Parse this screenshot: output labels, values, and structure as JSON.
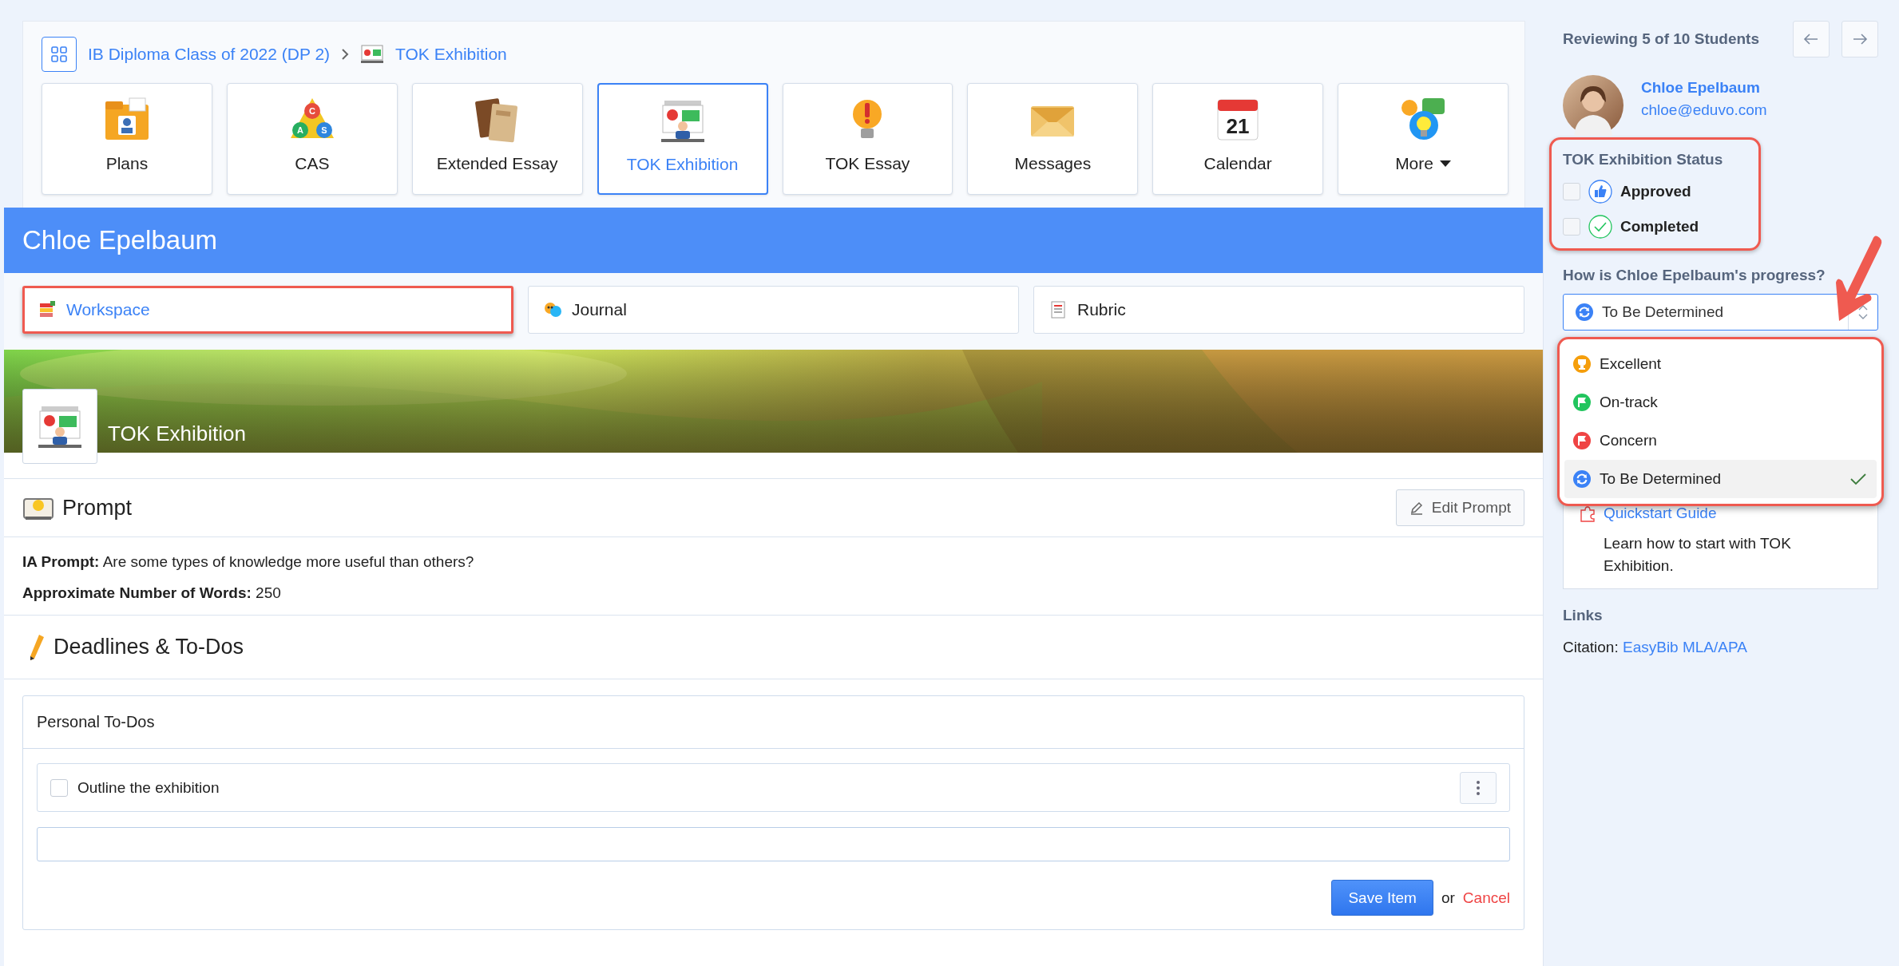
{
  "breadcrumb": [
    {
      "label": "IB Diploma Class of 2022 (DP 2)"
    },
    {
      "label": "TOK Exhibition"
    }
  ],
  "apps": [
    {
      "label": "Plans",
      "kind": "app",
      "selected": false
    },
    {
      "label": "CAS",
      "kind": "app",
      "selected": false,
      "icon_letters": [
        "C",
        "A",
        "S"
      ]
    },
    {
      "label": "Extended Essay",
      "kind": "app",
      "selected": false
    },
    {
      "label": "TOK Exhibition",
      "kind": "app",
      "selected": true
    },
    {
      "label": "TOK Essay",
      "kind": "app",
      "selected": false
    },
    {
      "label": "Messages",
      "kind": "app",
      "selected": false
    },
    {
      "label": "Calendar",
      "kind": "app",
      "selected": false,
      "icon_text": "21"
    },
    {
      "label": "More",
      "kind": "menu",
      "selected": false
    }
  ],
  "student": {
    "name": "Chloe Epelbaum"
  },
  "section_tabs": [
    {
      "label": "Workspace",
      "selected": true
    },
    {
      "label": "Journal",
      "selected": false
    },
    {
      "label": "Rubric",
      "selected": false
    }
  ],
  "banner": {
    "title": "TOK Exhibition"
  },
  "prompt": {
    "title": "Prompt",
    "edit_button": "Edit Prompt",
    "details": [
      "**IA Prompt:** Are some types of knowledge more useful than others?",
      "**Approximate Number of Words:** 250"
    ]
  },
  "deadlines": {
    "title": "Deadlines & To-Dos"
  },
  "todos": {
    "title": "Personal To-Dos",
    "items": [
      {
        "text": "Outline the exhibition",
        "checked": false
      }
    ],
    "save_button": "Save Item",
    "separator": "or",
    "cancel_link": "Cancel"
  },
  "review": {
    "counter": "Reviewing 5 of 10 Students",
    "student_name": "Chloe Epelbaum",
    "student_email": "chloe@eduvo.com",
    "status": {
      "title": "TOK Exhibition Status",
      "items": [
        {
          "label": "Approved",
          "checked": false
        },
        {
          "label": "Completed",
          "checked": false
        }
      ]
    },
    "progress": {
      "question": "How is Chloe Epelbaum's progress?",
      "value": "To Be Determined",
      "expanded": true,
      "options": [
        {
          "label": "Excellent",
          "selected": false,
          "color": "#f59e0b"
        },
        {
          "label": "On-track",
          "selected": false,
          "color": "#22c55e"
        },
        {
          "label": "Concern",
          "selected": false,
          "color": "#ef4444"
        },
        {
          "label": "To Be Determined",
          "selected": true,
          "color": "#3b82f6"
        }
      ]
    },
    "quickstart": {
      "link": "Quickstart Guide",
      "text": "Learn how to start with TOK Exhibition."
    },
    "links": {
      "title": "Links",
      "items": [
        {
          "label": "Citation:",
          "link": "EasyBib MLA/APA"
        }
      ]
    }
  }
}
